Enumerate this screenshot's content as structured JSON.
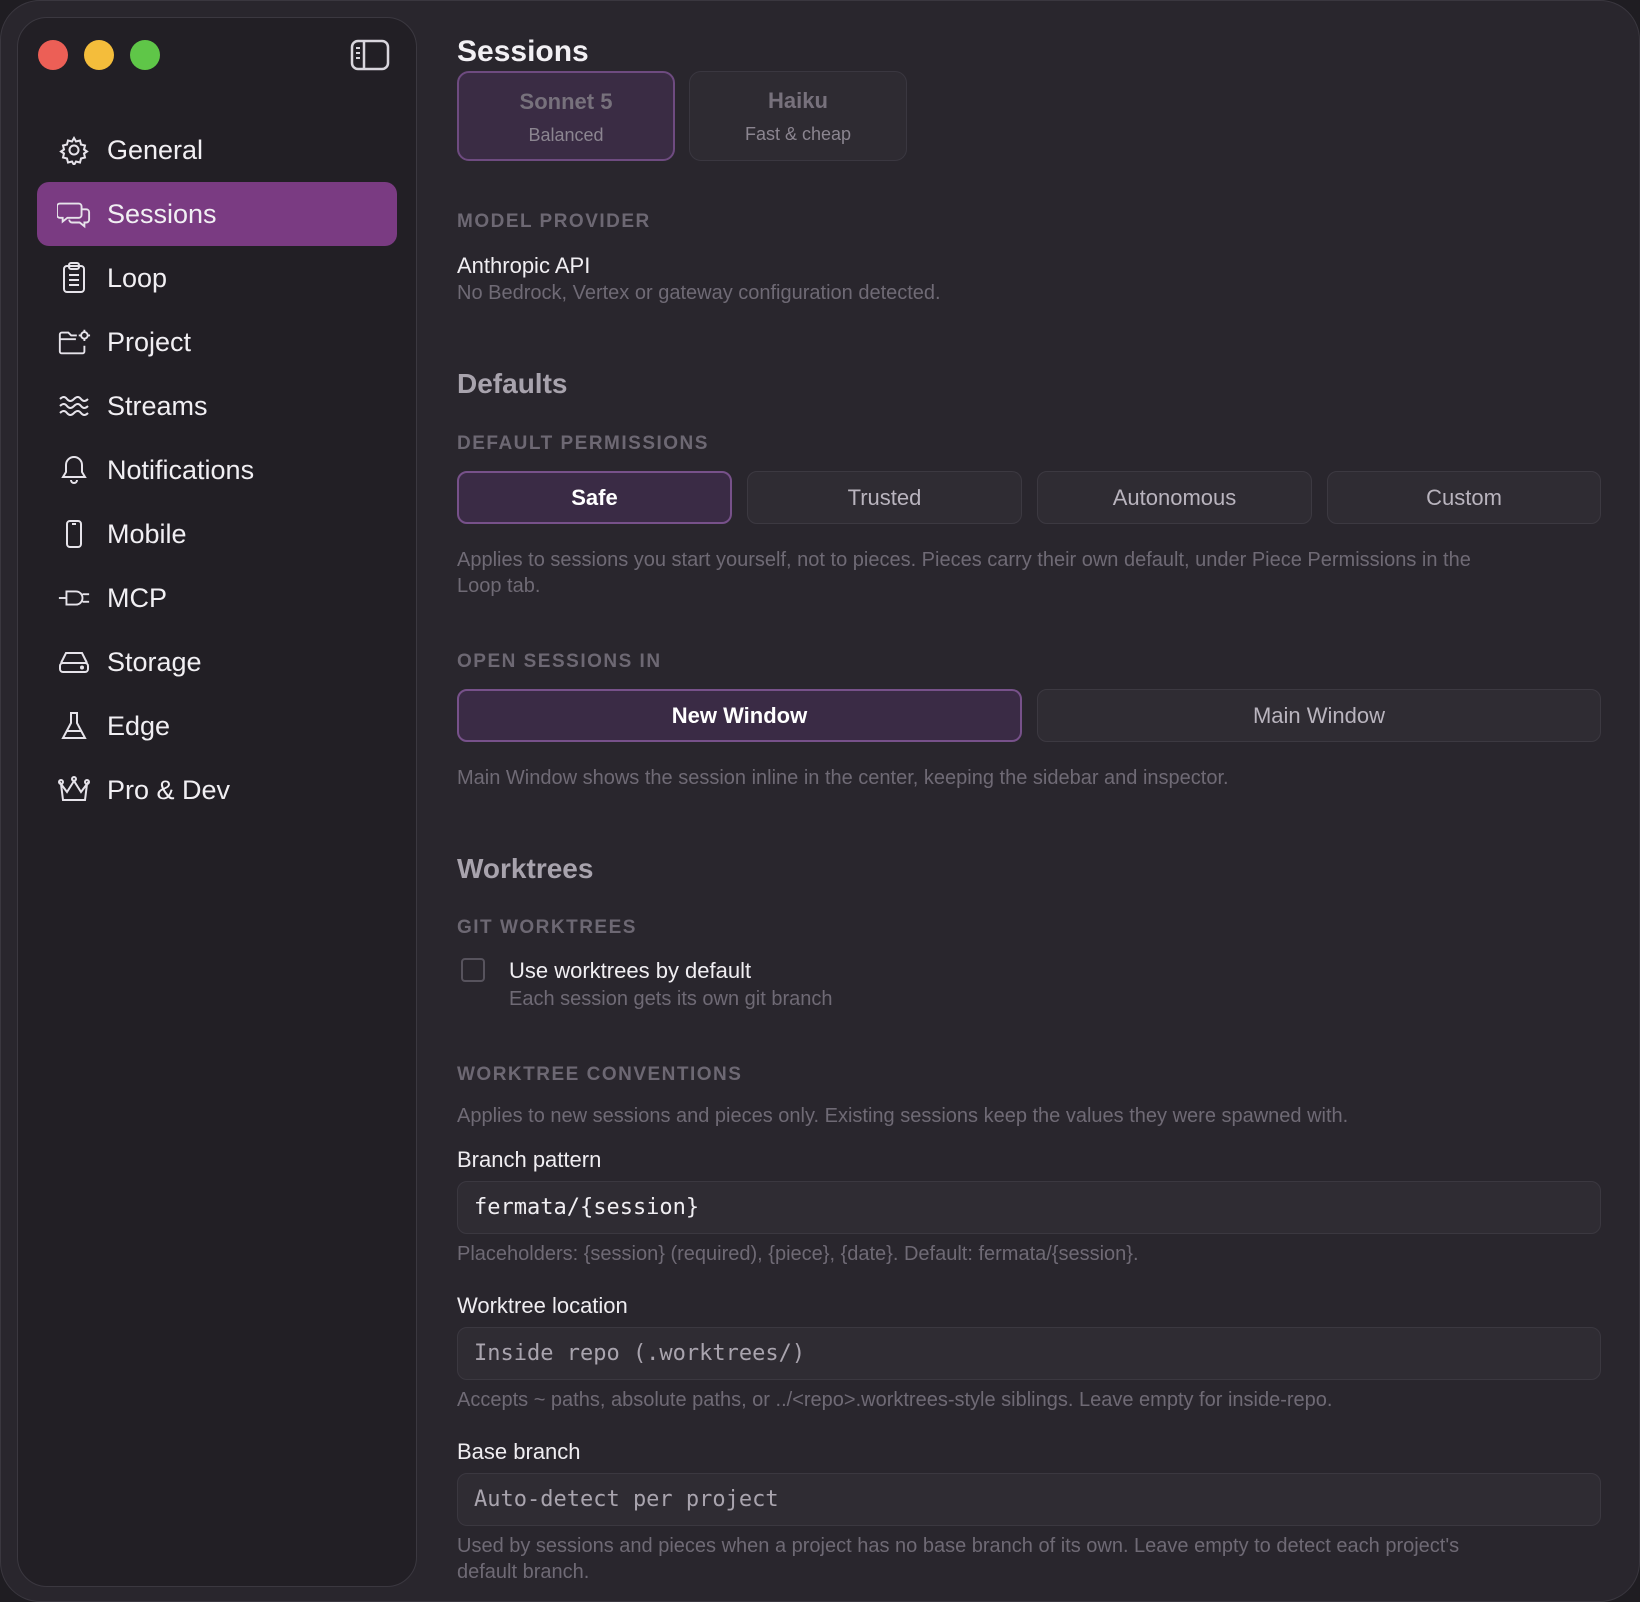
{
  "sidebar": {
    "items": [
      {
        "label": "General",
        "icon": "gear-icon"
      },
      {
        "label": "Sessions",
        "icon": "chat-bubbles-icon",
        "active": true
      },
      {
        "label": "Loop",
        "icon": "clipboard-icon"
      },
      {
        "label": "Project",
        "icon": "folder-gear-icon"
      },
      {
        "label": "Streams",
        "icon": "waves-icon"
      },
      {
        "label": "Notifications",
        "icon": "bell-icon"
      },
      {
        "label": "Mobile",
        "icon": "phone-icon"
      },
      {
        "label": "MCP",
        "icon": "plug-icon"
      },
      {
        "label": "Storage",
        "icon": "drive-icon"
      },
      {
        "label": "Edge",
        "icon": "flask-icon"
      },
      {
        "label": "Pro & Dev",
        "icon": "crown-icon"
      }
    ]
  },
  "main": {
    "title": "Sessions",
    "models": [
      {
        "name": "Sonnet 5",
        "sub": "Balanced",
        "selected": true
      },
      {
        "name": "Haiku",
        "sub": "Fast & cheap",
        "selected": false
      }
    ],
    "model_provider": {
      "label": "MODEL PROVIDER",
      "value": "Anthropic API",
      "note": "No Bedrock, Vertex or gateway configuration detected."
    },
    "defaults": {
      "heading": "Defaults",
      "permissions_label": "DEFAULT PERMISSIONS",
      "permissions": [
        "Safe",
        "Trusted",
        "Autonomous",
        "Custom"
      ],
      "permissions_selected": "Safe",
      "permissions_note_1": "Applies to sessions you start yourself, not to pieces. Pieces carry their own default, under Piece Permissions in the",
      "permissions_note_2": "Loop tab.",
      "open_label": "OPEN SESSIONS IN",
      "open_options": [
        "New Window",
        "Main Window"
      ],
      "open_selected": "New Window",
      "open_note": "Main Window shows the session inline in the center, keeping the sidebar and inspector."
    },
    "worktrees": {
      "heading": "Worktrees",
      "git_label": "GIT WORKTREES",
      "use_default_label": "Use worktrees by default",
      "use_default_note": "Each session gets its own git branch",
      "use_default_checked": false,
      "conventions_label": "WORKTREE CONVENTIONS",
      "conventions_note": "Applies to new sessions and pieces only. Existing sessions keep the values they were spawned with.",
      "branch_pattern_label": "Branch pattern",
      "branch_pattern_value": "fermata/{session}",
      "branch_pattern_note": "Placeholders: {session} (required), {piece}, {date}. Default: fermata/{session}.",
      "location_label": "Worktree location",
      "location_placeholder": "Inside repo (.worktrees/)",
      "location_note": "Accepts ~ paths, absolute paths, or ../<repo>.worktrees-style siblings. Leave empty for inside-repo.",
      "base_branch_label": "Base branch",
      "base_branch_placeholder": "Auto-detect per project",
      "base_branch_note_1": "Used by sessions and pieces when a project has no base branch of its own. Leave empty to detect each project's",
      "base_branch_note_2": "default branch."
    }
  },
  "colors": {
    "accent": "#7a3b82",
    "window_bg": "#29262d",
    "sidebar_bg": "#221f25"
  }
}
